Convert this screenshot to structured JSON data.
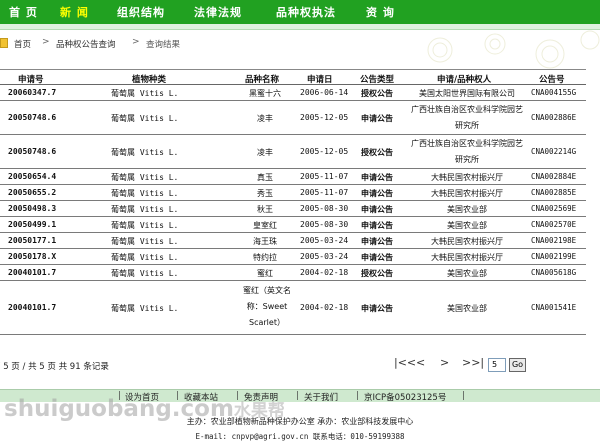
{
  "nav": {
    "items": [
      {
        "label": "首 页",
        "active": false
      },
      {
        "label": "新 闻",
        "active": true
      },
      {
        "label": "组织结构",
        "active": false
      },
      {
        "label": "法律法规",
        "active": false
      },
      {
        "label": "品种权执法",
        "active": false
      },
      {
        "label": "资 询",
        "active": false
      }
    ]
  },
  "breadcrumb": {
    "items": [
      "首页",
      "品种权公告查询",
      "查询结果"
    ],
    "separator": ">"
  },
  "table": {
    "columns": [
      "申请号",
      "植物种类",
      "品种名称",
      "申请日",
      "公告类型",
      "申请/品种权人",
      "公告号"
    ],
    "rows": [
      {
        "no": "20060347.7",
        "species": "葡萄属 Vitis L.",
        "variety": "黑蜜十六",
        "date": "2006-06-14",
        "type": "授权公告",
        "owner": "美国太阳世界国际有限公司",
        "pub": "CNA004155G"
      },
      {
        "no": "20050748.6",
        "species": "葡萄属 Vitis L.",
        "variety": "凌丰",
        "date": "2005-12-05",
        "type": "申请公告",
        "owner": "广西壮族自治区农业科学院园艺研究所",
        "pub": "CNA002886E"
      },
      {
        "no": "20050748.6",
        "species": "葡萄属 Vitis L.",
        "variety": "凌丰",
        "date": "2005-12-05",
        "type": "授权公告",
        "owner": "广西壮族自治区农业科学院园艺研究所",
        "pub": "CNA002214G"
      },
      {
        "no": "20050654.4",
        "species": "葡萄属 Vitis L.",
        "variety": "真玉",
        "date": "2005-11-07",
        "type": "申请公告",
        "owner": "大韩民国农村振兴厅",
        "pub": "CNA002884E"
      },
      {
        "no": "20050655.2",
        "species": "葡萄属 Vitis L.",
        "variety": "秀玉",
        "date": "2005-11-07",
        "type": "申请公告",
        "owner": "大韩民国农村振兴厅",
        "pub": "CNA002885E"
      },
      {
        "no": "20050498.3",
        "species": "葡萄属 Vitis L.",
        "variety": "秋王",
        "date": "2005-08-30",
        "type": "申请公告",
        "owner": "美国农业部",
        "pub": "CNA002569E"
      },
      {
        "no": "20050499.1",
        "species": "葡萄属 Vitis L.",
        "variety": "皇室红",
        "date": "2005-08-30",
        "type": "申请公告",
        "owner": "美国农业部",
        "pub": "CNA002570E"
      },
      {
        "no": "20050177.1",
        "species": "葡萄属 Vitis L.",
        "variety": "海王珠",
        "date": "2005-03-24",
        "type": "申请公告",
        "owner": "大韩民国农村振兴厅",
        "pub": "CNA002198E"
      },
      {
        "no": "20050178.X",
        "species": "葡萄属 Vitis L.",
        "variety": "特约拉",
        "date": "2005-03-24",
        "type": "申请公告",
        "owner": "大韩民国农村振兴厅",
        "pub": "CNA002199E"
      },
      {
        "no": "20040101.7",
        "species": "葡萄属 Vitis L.",
        "variety": "蜜红",
        "date": "2004-02-18",
        "type": "授权公告",
        "owner": "美国农业部",
        "pub": "CNA005618G"
      },
      {
        "no": "20040101.7",
        "species": "葡萄属 Vitis L.",
        "variety": "蜜红（英文名称：Sweet Scarlet）",
        "date": "2004-02-18",
        "type": "申请公告",
        "owner": "美国农业部",
        "pub": "CNA001541E"
      }
    ]
  },
  "pager": {
    "summary": "第 5 页 / 共 5 页 共 91 条记录",
    "first": "|<<",
    "prev": "<",
    "next": ">",
    "last": ">>|",
    "page_value": "5",
    "go_label": "Go"
  },
  "footer": {
    "links": [
      "设为首页",
      "收藏本站",
      "免责声明",
      "关于我们",
      "京ICP备05023125号"
    ],
    "line1": "主办：农业部植物新品种保护办公室   承办：农业部科技发展中心",
    "line2": "E-mail: cnpvp@agri.gov.cn        联系电话：010-59199388"
  },
  "watermark": {
    "text": "shuiguobang.com",
    "logo_text": "水果帮"
  },
  "colors": {
    "nav_bg": "#21a121",
    "nav_active": "#ffff00",
    "footer_bg": "#cfe9cf"
  }
}
